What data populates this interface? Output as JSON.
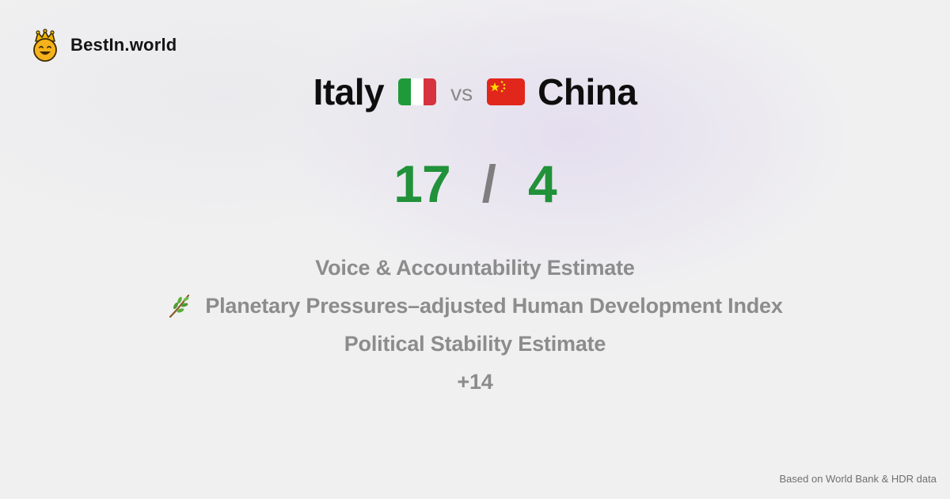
{
  "brand": {
    "name": "BestIn.world",
    "logo_icon": "crowned-smiley-icon"
  },
  "comparison": {
    "country_a": {
      "name": "Italy",
      "flag_icon": "italy-flag-icon"
    },
    "vs_label": "vs",
    "country_b": {
      "name": "China",
      "flag_icon": "china-flag-icon"
    }
  },
  "scores": {
    "a": "17",
    "separator": "/",
    "b": "4",
    "color": "#21913a"
  },
  "metrics": [
    {
      "label": "Voice & Accountability Estimate"
    },
    {
      "label": "Planetary Pressures–adjusted Human Development Index",
      "icon": "herb-branch-icon"
    },
    {
      "label": "Political Stability Estimate"
    },
    {
      "label": "+14"
    }
  ],
  "footer": {
    "source": "Based on World Bank & HDR data"
  }
}
